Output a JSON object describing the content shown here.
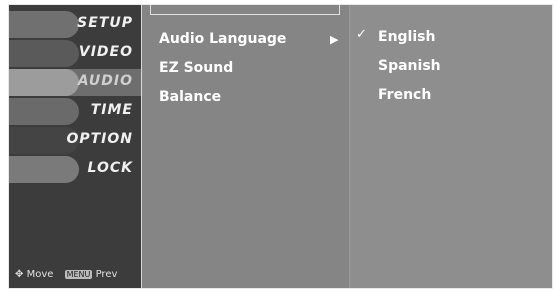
{
  "sidebar": {
    "categories": [
      {
        "label": "SETUP",
        "thumb_color": "#707070"
      },
      {
        "label": "VIDEO",
        "thumb_color": "#5a5a5a"
      },
      {
        "label": "AUDIO",
        "thumb_color": "#9c9c9c"
      },
      {
        "label": "TIME",
        "thumb_color": "#6a6a6a"
      },
      {
        "label": "OPTION",
        "thumb_color": "#444444"
      },
      {
        "label": "LOCK",
        "thumb_color": "#7a7a7a"
      }
    ],
    "active_index": 2,
    "hints": {
      "move_label": "Move",
      "move_icon": "dpad-icon",
      "prev_key": "MENU",
      "prev_label": "Prev"
    }
  },
  "submenu": {
    "items": [
      "Audio Language",
      "EZ Sound",
      "Balance"
    ],
    "selected_index": 0,
    "arrow_glyph": "▶"
  },
  "options": {
    "items": [
      "English",
      "Spanish",
      "French"
    ],
    "checked_index": 0,
    "check_glyph": "✓"
  }
}
